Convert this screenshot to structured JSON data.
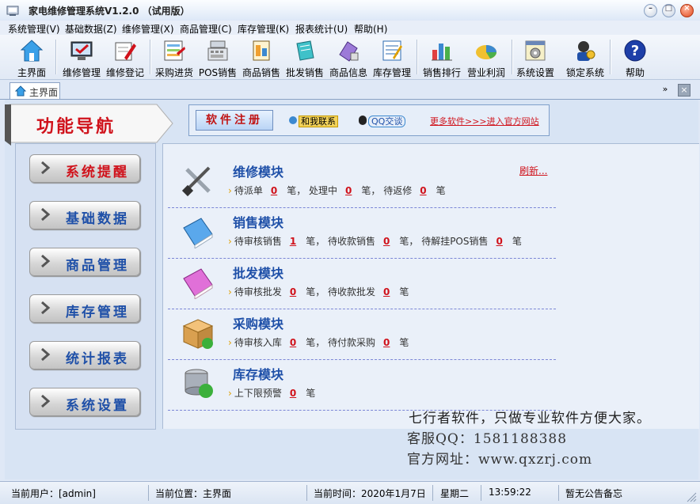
{
  "window": {
    "title": "家电维修管理系统V1.2.0 （试用版）"
  },
  "menu": [
    "系统管理(V)",
    "基础数据(Z)",
    "维修管理(X)",
    "商品管理(C)",
    "库存管理(K)",
    "报表统计(U)",
    "帮助(H)"
  ],
  "toolbar": [
    {
      "label": "主界面",
      "icon": "home-icon"
    },
    {
      "label": "维修管理",
      "icon": "monitor-repair-icon"
    },
    {
      "label": "维修登记",
      "icon": "register-pen-icon"
    },
    {
      "label": "采购进货",
      "icon": "purchase-sheet-icon"
    },
    {
      "label": "POS销售",
      "icon": "cash-register-icon"
    },
    {
      "label": "商品销售",
      "icon": "sales-doc-icon"
    },
    {
      "label": "批发销售",
      "icon": "wholesale-notebook-icon"
    },
    {
      "label": "商品信息",
      "icon": "product-info-icon"
    },
    {
      "label": "库存管理",
      "icon": "inventory-icon"
    },
    {
      "label": "销售排行",
      "icon": "bar-chart-icon"
    },
    {
      "label": "营业利润",
      "icon": "pie-chart-icon"
    },
    {
      "label": "系统设置",
      "icon": "settings-icon"
    },
    {
      "label": "锁定系统",
      "icon": "lock-user-icon"
    },
    {
      "label": "帮助",
      "icon": "help-icon"
    }
  ],
  "tab": {
    "label": "主界面"
  },
  "nav": {
    "title": "功能导航",
    "buttons": [
      "系统提醒",
      "基础数据",
      "商品管理",
      "库存管理",
      "统计报表",
      "系统设置"
    ]
  },
  "regbar": {
    "register": "软件注册",
    "contact": "和我联系",
    "qq": "QQ交谈",
    "more": "更多软件>>>进入官方网站"
  },
  "modules": [
    {
      "title": "维修模块",
      "line": [
        "待派单",
        "0",
        "笔， 处理中",
        "0",
        "笔， 待返修",
        "0",
        "笔"
      ]
    },
    {
      "title": "销售模块",
      "line": [
        "待审核销售",
        "1",
        "笔， 待收款销售",
        "0",
        "笔， 待解挂POS销售",
        "0",
        "笔"
      ]
    },
    {
      "title": "批发模块",
      "line": [
        "待审核批发",
        "0",
        "笔， 待收款批发",
        "0",
        "笔"
      ]
    },
    {
      "title": "采购模块",
      "line": [
        "待审核入库",
        "0",
        "笔， 待付款采购",
        "0",
        "笔"
      ]
    },
    {
      "title": "库存模块",
      "line": [
        "上下限预警",
        "0",
        "笔"
      ]
    }
  ],
  "refresh": "刷新...",
  "slogan": "七行者软件，只做专业软件方便大家。",
  "support": {
    "qq": "客服QQ：1581188388",
    "site": "官方网址：www.qxzrj.com"
  },
  "status": {
    "user": "当前用户：[admin]",
    "location": "当前位置：主界面",
    "time_label": "当前时间：2020年1月7日",
    "weekday": "星期二",
    "clock": "13:59:22",
    "notice": "暂无公告备忘"
  },
  "colors": {
    "accent_red": "#d0121b",
    "nav_blue": "#1f50a8",
    "dash": "#7b86d6"
  }
}
